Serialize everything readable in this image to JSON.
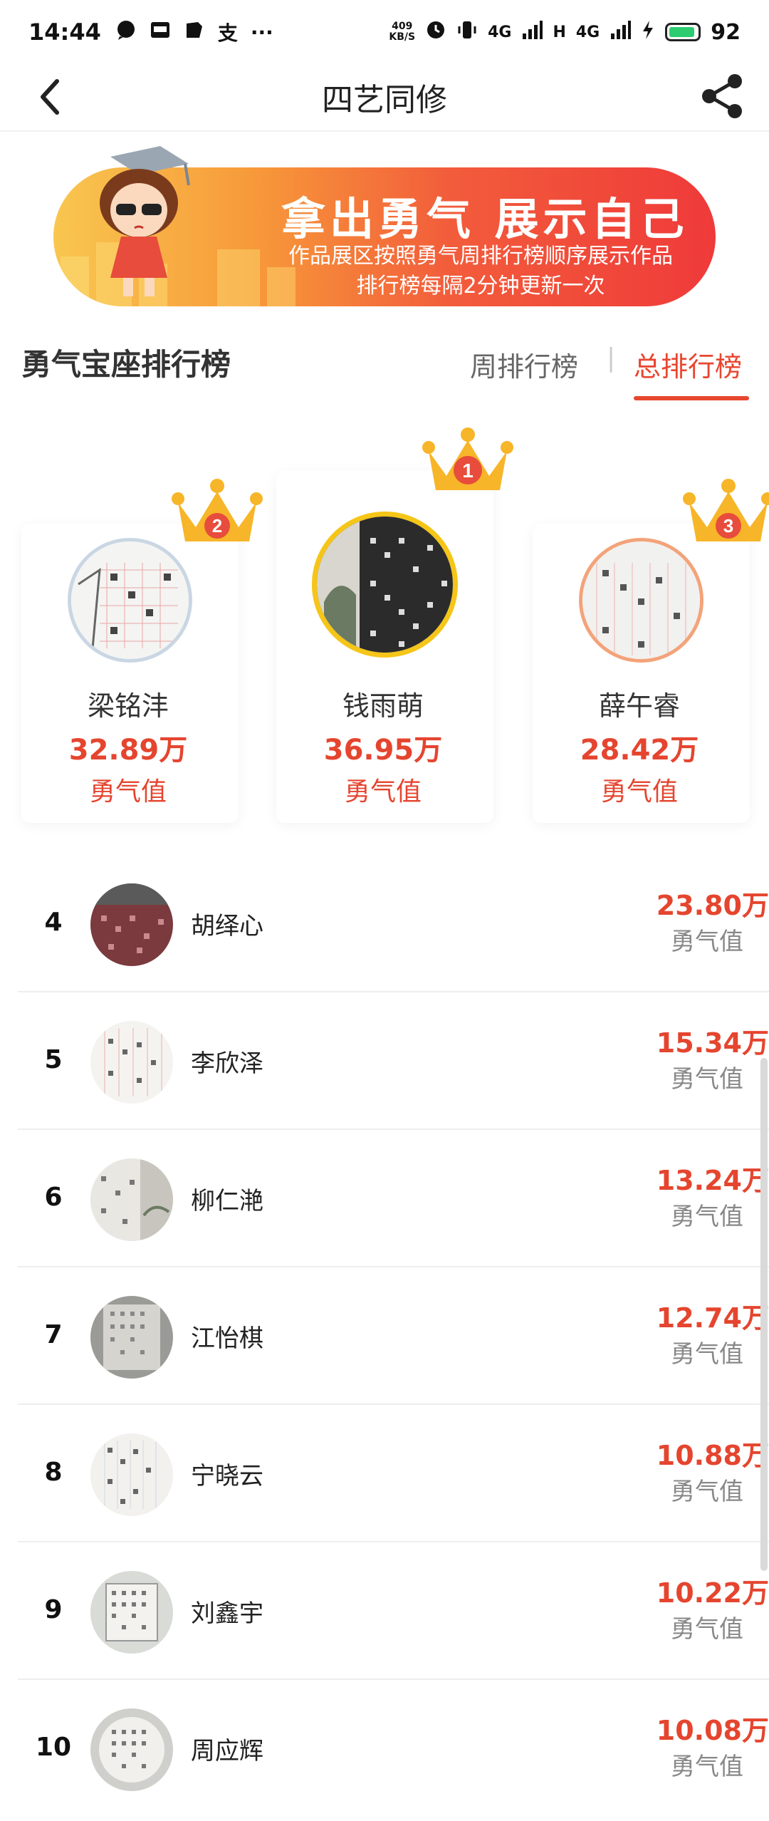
{
  "status_bar": {
    "time": "14:44",
    "left_icons": [
      "chat-bubble-icon",
      "app-icon",
      "notes-icon",
      "alipay-icon",
      "more-icon"
    ],
    "alipay_glyph": "支",
    "more_glyph": "···",
    "net_speed_value": "409",
    "net_speed_unit": "KB/S",
    "signal_label_1": "4G",
    "signal_label_2": "4G",
    "hd_label": "H",
    "battery": "92"
  },
  "nav": {
    "title": "四艺同修"
  },
  "banner": {
    "title": "拿出勇气  展示自己",
    "line1": "作品展区按照勇气周排行榜顺序展示作品",
    "line2": "排行榜每隔2分钟更新一次"
  },
  "section": {
    "title": "勇气宝座排行榜",
    "tab_weekly": "周排行榜",
    "tab_separator": "|",
    "tab_total": "总排行榜",
    "active_tab": "总排行榜"
  },
  "podium": [
    {
      "rank": "2",
      "name": "梁铭沣",
      "score": "32.89万",
      "label": "勇气值"
    },
    {
      "rank": "1",
      "name": "钱雨萌",
      "score": "36.95万",
      "label": "勇气值"
    },
    {
      "rank": "3",
      "name": "薛午睿",
      "score": "28.42万",
      "label": "勇气值"
    }
  ],
  "rankings": [
    {
      "rank": "4",
      "name": "胡绎心",
      "score": "23.80万",
      "label": "勇气值"
    },
    {
      "rank": "5",
      "name": "李欣泽",
      "score": "15.34万",
      "label": "勇气值"
    },
    {
      "rank": "6",
      "name": "柳仁滟",
      "score": "13.24万",
      "label": "勇气值"
    },
    {
      "rank": "7",
      "name": "江怡棋",
      "score": "12.74万",
      "label": "勇气值"
    },
    {
      "rank": "8",
      "name": "宁晓云",
      "score": "10.88万",
      "label": "勇气值"
    },
    {
      "rank": "9",
      "name": "刘鑫宇",
      "score": "10.22万",
      "label": "勇气值"
    },
    {
      "rank": "10",
      "name": "周应辉",
      "score": "10.08万",
      "label": "勇气值"
    }
  ],
  "colors": {
    "accent": "#e5452f",
    "banner_start": "#f9c64f",
    "banner_end": "#ef3a3a",
    "crown": "#f7b529"
  }
}
